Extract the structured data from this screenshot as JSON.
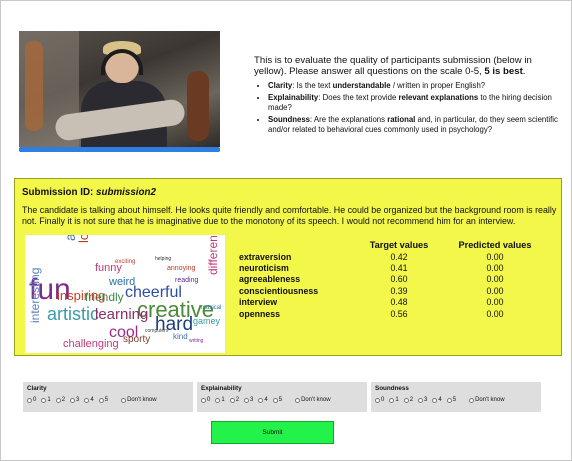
{
  "instructions": {
    "intro_text": "This is to evaluate the quality of participants submission (below in yellow). Please answer all questions on the scale 0-5, ",
    "intro_bold": "5 is best",
    "intro_end": ".",
    "criteria": [
      {
        "name": "Clarity",
        "pre": ": Is the text ",
        "bold": "understandable",
        "post": " / written in proper English?"
      },
      {
        "name": "Explainability",
        "pre": ": Does the text provide ",
        "bold": "relevant explanations",
        "post": " to the hiring decision made?"
      },
      {
        "name": "Soundness",
        "pre": ": Are the explanations ",
        "bold": "rational",
        "post": " and, in particular, do they seem scientific and/or related to behavioral cues commonly used in psychology?"
      }
    ]
  },
  "video": {
    "progress_fraction": 1.0
  },
  "submission": {
    "id_label": "Submission ID: ",
    "id_value": "submission2",
    "text": "The candidate is talking about himself. He looks quite friendly and comfortable. He could be organized but the background room is really not. Finally it is not sure that he is imaginative due to the monotony of its speech. I would not recommend him for an interview.",
    "table_headers": [
      "Target values",
      "Predicted values"
    ],
    "traits": [
      {
        "name": "extraversion",
        "target": "0.42",
        "predicted": "0.00"
      },
      {
        "name": "neuroticism",
        "target": "0.41",
        "predicted": "0.00"
      },
      {
        "name": "agreeableness",
        "target": "0.60",
        "predicted": "0.00"
      },
      {
        "name": "conscientiousness",
        "target": "0.39",
        "predicted": "0.00"
      },
      {
        "name": "interview",
        "target": "0.48",
        "predicted": "0.00"
      },
      {
        "name": "openness",
        "target": "0.56",
        "predicted": "0.00"
      }
    ],
    "wordcloud_words": [
      "fun",
      "awesome",
      "loud",
      "funny",
      "weird",
      "friendly",
      "cheerful",
      "creative",
      "artistic",
      "learning",
      "hard",
      "interesting",
      "inspiring",
      "cool",
      "challenging",
      "sporty",
      "different",
      "exciting",
      "annoying",
      "reading",
      "musical",
      "gamey",
      "kind",
      "computers",
      "helping",
      "writing"
    ]
  },
  "ratings": [
    {
      "title": "Clarity",
      "options": [
        "0",
        "1",
        "2",
        "3",
        "4",
        "5"
      ],
      "dont_know": "Don't know"
    },
    {
      "title": "Explainability",
      "options": [
        "0",
        "1",
        "2",
        "3",
        "4",
        "5"
      ],
      "dont_know": "Don't know"
    },
    {
      "title": "Soundness",
      "options": [
        "0",
        "1",
        "2",
        "3",
        "4",
        "5"
      ],
      "dont_know": "Don't know"
    }
  ],
  "submit_label": "Submit",
  "colors": {
    "submission_bg": "#f2f74a",
    "submit_bg": "#22f24a",
    "progress": "#2f7fe0"
  }
}
